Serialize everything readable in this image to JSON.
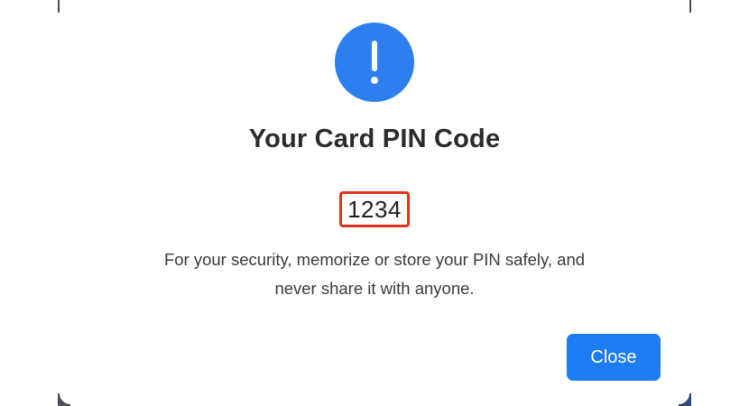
{
  "dialog": {
    "icon": "exclamation-icon",
    "icon_color": "#2d7ff0",
    "icon_glyph": "!",
    "title": "Your Card PIN Code",
    "pin": "1234",
    "pin_highlight_color": "#e2311d",
    "message": "For your security, memorize or store your PIN safely, and never share it with anyone.",
    "close_label": "Close",
    "button_color": "#1d7cf2"
  }
}
